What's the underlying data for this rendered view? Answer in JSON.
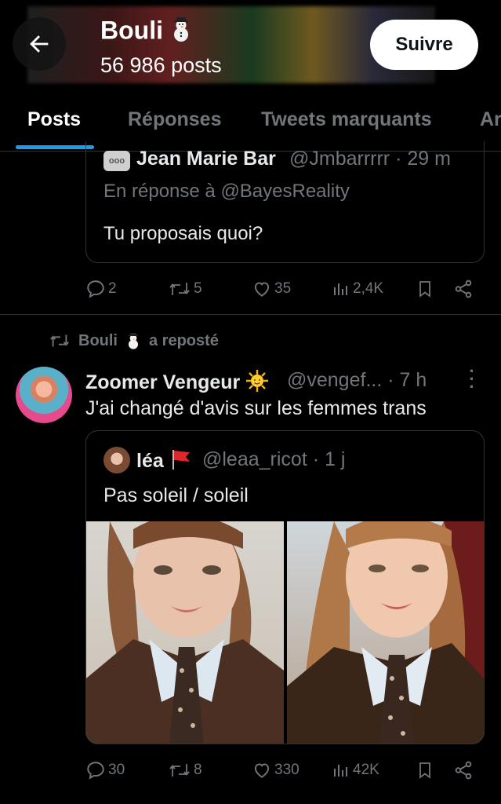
{
  "header": {
    "title": "Bouli",
    "posts_count": "56 986 posts",
    "follow_label": "Suivre"
  },
  "tabs": [
    {
      "label": "Posts",
      "active": true
    },
    {
      "label": "Réponses",
      "active": false
    },
    {
      "label": "Tweets marquants",
      "active": false
    },
    {
      "label": "Ar",
      "active": false
    }
  ],
  "tweet1": {
    "quoted": {
      "avatar_text": "ooo",
      "name": "Jean Marie Bar",
      "handle_time": "@Jmbarrrrr · 29 m",
      "reply_to": "En réponse à @BayesReality",
      "text": "Tu proposais quoi?"
    },
    "actions": {
      "replies": "2",
      "retweets": "5",
      "likes": "35",
      "views": "2,4K"
    }
  },
  "repost": {
    "by": "Bouli",
    "label": "a reposté"
  },
  "tweet2": {
    "name": "Zoomer Vengeur",
    "handle_time": "@vengef... · 7 h",
    "text": "J'ai changé d'avis sur les femmes trans",
    "quoted": {
      "name": "léa",
      "handle_time": "@leaa_ricot · 1 j",
      "text": "Pas soleil / soleil"
    },
    "actions": {
      "replies": "30",
      "retweets": "8",
      "likes": "330",
      "views": "42K"
    }
  },
  "colors": {
    "background": "#000000",
    "text": "#e7e9ea",
    "muted": "#71767b",
    "accent": "#1d9bf0",
    "border": "#2f3336"
  }
}
